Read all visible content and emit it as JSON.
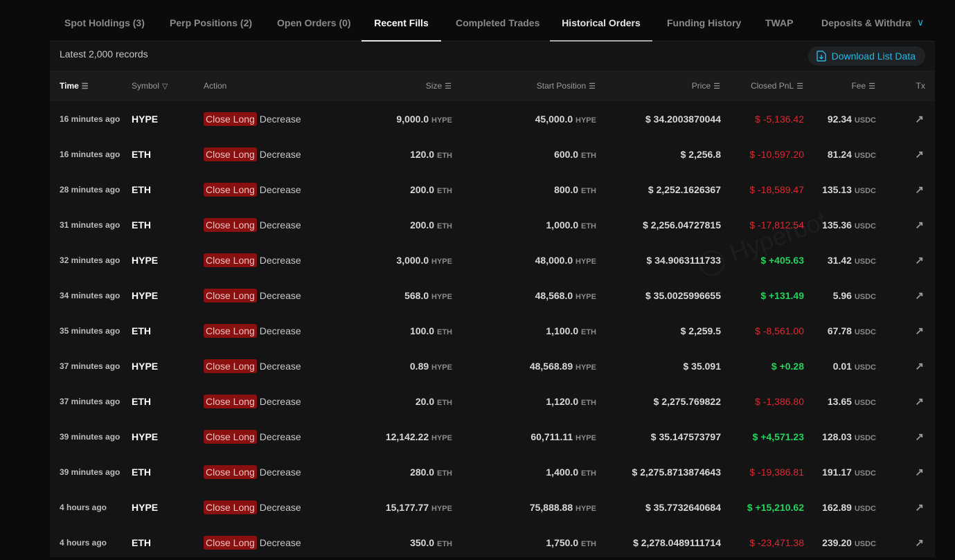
{
  "tabs": [
    "Spot Holdings (3)",
    "Perp Positions (2)",
    "Open Orders (0)",
    "Recent Fills",
    "Completed Trades",
    "Historical Orders",
    "Funding History",
    "TWAP",
    "Deposits & Withdraw"
  ],
  "active_tab": "Recent Fills",
  "records_label": "Latest 2,000 records",
  "download_label": "Download List Data",
  "watermark": "Hyperbot",
  "columns": {
    "time": "Time",
    "symbol": "Symbol",
    "action": "Action",
    "size": "Size",
    "start": "Start Position",
    "price": "Price",
    "pnl": "Closed PnL",
    "fee": "Fee",
    "tx": "Tx"
  },
  "colors": {
    "accent": "#2ab6e0",
    "negative": "#e0282e",
    "positive": "#22d35c",
    "badge": "#8a1010"
  },
  "rows": [
    {
      "time": "16 minutes ago",
      "symbol": "HYPE",
      "side": "Close Long",
      "dir": "Decrease",
      "size": "9,000.0",
      "start": "45,000.0",
      "price": "$ 34.2003870044",
      "pnl": "$ -5,136.42",
      "fee": "92.34",
      "fee_unit": "USDC"
    },
    {
      "time": "16 minutes ago",
      "symbol": "ETH",
      "side": "Close Long",
      "dir": "Decrease",
      "size": "120.0",
      "start": "600.0",
      "price": "$ 2,256.8",
      "pnl": "$ -10,597.20",
      "fee": "81.24",
      "fee_unit": "USDC"
    },
    {
      "time": "28 minutes ago",
      "symbol": "ETH",
      "side": "Close Long",
      "dir": "Decrease",
      "size": "200.0",
      "start": "800.0",
      "price": "$ 2,252.1626367",
      "pnl": "$ -18,589.47",
      "fee": "135.13",
      "fee_unit": "USDC"
    },
    {
      "time": "31 minutes ago",
      "symbol": "ETH",
      "side": "Close Long",
      "dir": "Decrease",
      "size": "200.0",
      "start": "1,000.0",
      "price": "$ 2,256.04727815",
      "pnl": "$ -17,812.54",
      "fee": "135.36",
      "fee_unit": "USDC"
    },
    {
      "time": "32 minutes ago",
      "symbol": "HYPE",
      "side": "Close Long",
      "dir": "Decrease",
      "size": "3,000.0",
      "start": "48,000.0",
      "price": "$ 34.9063111733",
      "pnl": "$ +405.63",
      "fee": "31.42",
      "fee_unit": "USDC"
    },
    {
      "time": "34 minutes ago",
      "symbol": "HYPE",
      "side": "Close Long",
      "dir": "Decrease",
      "size": "568.0",
      "start": "48,568.0",
      "price": "$ 35.0025996655",
      "pnl": "$ +131.49",
      "fee": "5.96",
      "fee_unit": "USDC"
    },
    {
      "time": "35 minutes ago",
      "symbol": "ETH",
      "side": "Close Long",
      "dir": "Decrease",
      "size": "100.0",
      "start": "1,100.0",
      "price": "$ 2,259.5",
      "pnl": "$ -8,561.00",
      "fee": "67.78",
      "fee_unit": "USDC"
    },
    {
      "time": "37 minutes ago",
      "symbol": "HYPE",
      "side": "Close Long",
      "dir": "Decrease",
      "size": "0.89",
      "start": "48,568.89",
      "price": "$ 35.091",
      "pnl": "$ +0.28",
      "fee": "0.01",
      "fee_unit": "USDC"
    },
    {
      "time": "37 minutes ago",
      "symbol": "ETH",
      "side": "Close Long",
      "dir": "Decrease",
      "size": "20.0",
      "start": "1,120.0",
      "price": "$ 2,275.769822",
      "pnl": "$ -1,386.80",
      "fee": "13.65",
      "fee_unit": "USDC"
    },
    {
      "time": "39 minutes ago",
      "symbol": "HYPE",
      "side": "Close Long",
      "dir": "Decrease",
      "size": "12,142.22",
      "start": "60,711.11",
      "price": "$ 35.147573797",
      "pnl": "$ +4,571.23",
      "fee": "128.03",
      "fee_unit": "USDC"
    },
    {
      "time": "39 minutes ago",
      "symbol": "ETH",
      "side": "Close Long",
      "dir": "Decrease",
      "size": "280.0",
      "start": "1,400.0",
      "price": "$ 2,275.8713874643",
      "pnl": "$ -19,386.81",
      "fee": "191.17",
      "fee_unit": "USDC"
    },
    {
      "time": "4 hours ago",
      "symbol": "HYPE",
      "side": "Close Long",
      "dir": "Decrease",
      "size": "15,177.77",
      "start": "75,888.88",
      "price": "$ 35.7732640684",
      "pnl": "$ +15,210.62",
      "fee": "162.89",
      "fee_unit": "USDC"
    },
    {
      "time": "4 hours ago",
      "symbol": "ETH",
      "side": "Close Long",
      "dir": "Decrease",
      "size": "350.0",
      "start": "1,750.0",
      "price": "$ 2,278.0489111714",
      "pnl": "$ -23,471.38",
      "fee": "239.20",
      "fee_unit": "USDC"
    }
  ]
}
